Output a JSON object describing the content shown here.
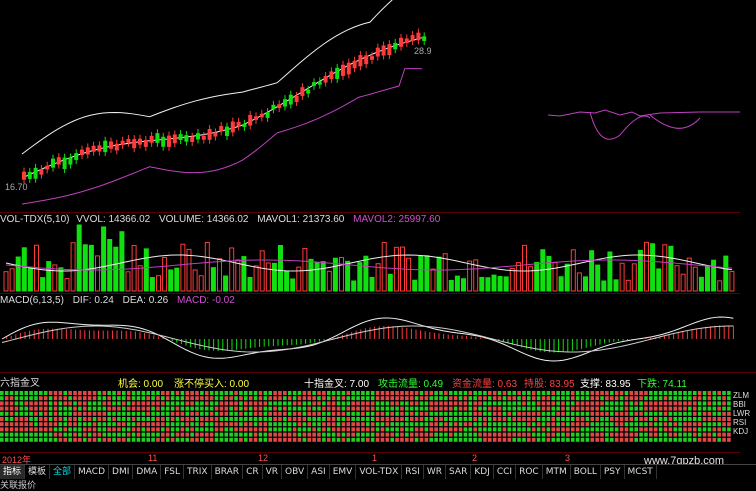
{
  "price_pane": {
    "price_label_top": "28.9",
    "price_label_left": "16.70"
  },
  "volume_pane": {
    "title": "VOL-TDX(5,10)",
    "vvol": "VVOL: 14366.02",
    "volume": "VOLUME: 14366.02",
    "mavol1": "MAVOL1: 21373.60",
    "mavol2": "MAVOL2: 25997.60"
  },
  "macd_pane": {
    "title": "MACD(6,13,5)",
    "dif": "DIF: 0.24",
    "dea": "DEA: 0.26",
    "macd": "MACD: -0.02"
  },
  "signal_pane": {
    "title": "六指金叉",
    "opportunity": "机会: 0.00",
    "limit_up_buy": "涨不停买入: 0.00",
    "ten_cross": "十指金叉: 7.00",
    "attack_flow": "攻击流量: 0.49",
    "capital_flow": "资金流量: 0.63",
    "hold": "持股: 83.95",
    "support": "支撑: 83.95",
    "fall": "下跌: 74.11",
    "row_labels": [
      "ZLM",
      "BBI",
      "LWR",
      "RSI",
      "KDJ"
    ]
  },
  "time_axis": {
    "labels": [
      "2012年",
      "11",
      "12",
      "1",
      "2",
      "3"
    ]
  },
  "tabs": {
    "items": [
      "指标",
      "模板",
      "全部",
      "MACD",
      "DMI",
      "DMA",
      "FSL",
      "TRIX",
      "BRAR",
      "CR",
      "VR",
      "OBV",
      "ASI",
      "EMV",
      "VOL-TDX",
      "RSI",
      "WR",
      "SAR",
      "KDJ",
      "CCI",
      "ROC",
      "MTM",
      "BOLL",
      "PSY",
      "MCST"
    ],
    "active_index": 0,
    "selected_index": 2
  },
  "bottom_text": "关联报价",
  "watermark": "www.7gpzb.com",
  "colors": {
    "up": "#ff3b3b",
    "down": "#10e010",
    "white_line": "#f0f0f0",
    "purple_line": "#c040c0",
    "yellow": "#ffff40",
    "cyan": "#00d0d0"
  }
}
